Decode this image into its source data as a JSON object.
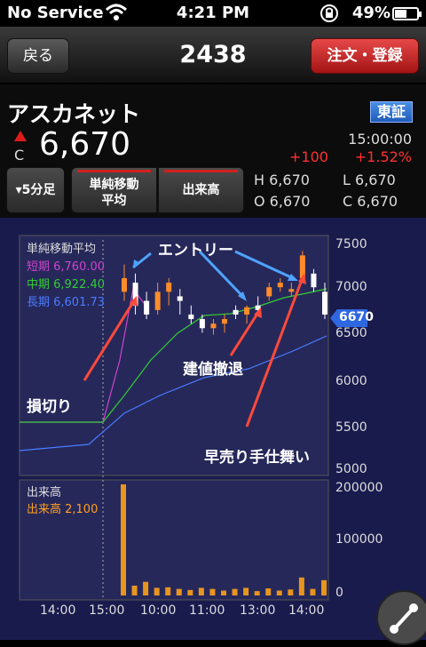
{
  "status": {
    "carrier": "No Service",
    "time": "4:21 PM",
    "battery": "49%"
  },
  "nav": {
    "back": "戻る",
    "title": "2438",
    "order": "注文・登録"
  },
  "stock": {
    "name": "アスカネット",
    "exchange": "東証",
    "price_label": "C",
    "price": "6,670",
    "time": "15:00:00",
    "change": "+100",
    "change_pct": "+1.52%"
  },
  "controls": {
    "period": "▾5分足",
    "ma": "単純移動\n平均",
    "volume": "出来高"
  },
  "ohlc": {
    "h": "H 6,670",
    "l": "L 6,670",
    "o": "O 6,670",
    "c": "C 6,670"
  },
  "chart": {
    "legend_title": "単純移動平均",
    "short": "短期 6,760.00",
    "mid": "中期 6,922.40",
    "long": "長期 6,601.73",
    "price_axis": [
      "7500",
      "7000",
      "6500",
      "6000",
      "5500",
      "5000"
    ],
    "current_tag": "6670",
    "vol_title": "出来高",
    "vol_value": "出来高 2,100",
    "vol_axis": [
      "200000",
      "100000",
      "0"
    ],
    "time_axis": [
      "14:00",
      "15:00",
      "10:00",
      "11:00",
      "13:00",
      "14:00"
    ],
    "annotations": {
      "entry": "エントリー",
      "breakeven": "建値撤退",
      "stop": "損切り",
      "early": "早売り手仕舞い"
    },
    "colors": {
      "short": "#cc44cc",
      "mid": "#33cc33",
      "long": "#4a7cff",
      "up": "#ff8c2a",
      "down": "#ffffff",
      "bg": "#1a1b4d"
    }
  },
  "chart_data": {
    "type": "candlestick",
    "ylim": [
      5000,
      7500
    ],
    "candles": [
      {
        "o": 6950,
        "h": 7250,
        "l": 6850,
        "c": 7100
      },
      {
        "o": 7050,
        "h": 7150,
        "l": 6700,
        "c": 6800
      },
      {
        "o": 6850,
        "h": 6950,
        "l": 6650,
        "c": 6700
      },
      {
        "o": 6750,
        "h": 7050,
        "l": 6700,
        "c": 6950
      },
      {
        "o": 6950,
        "h": 7100,
        "l": 6800,
        "c": 7050
      },
      {
        "o": 6900,
        "h": 6980,
        "l": 6700,
        "c": 6850
      },
      {
        "o": 6700,
        "h": 6800,
        "l": 6600,
        "c": 6650
      },
      {
        "o": 6650,
        "h": 6700,
        "l": 6500,
        "c": 6550
      },
      {
        "o": 6550,
        "h": 6650,
        "l": 6480,
        "c": 6600
      },
      {
        "o": 6600,
        "h": 6700,
        "l": 6500,
        "c": 6650
      },
      {
        "o": 6750,
        "h": 6800,
        "l": 6650,
        "c": 6700
      },
      {
        "o": 6700,
        "h": 6800,
        "l": 6600,
        "c": 6780
      },
      {
        "o": 6800,
        "h": 6900,
        "l": 6700,
        "c": 6750
      },
      {
        "o": 6900,
        "h": 7050,
        "l": 6850,
        "c": 7000
      },
      {
        "o": 7000,
        "h": 7100,
        "l": 6950,
        "c": 7050
      },
      {
        "o": 6950,
        "h": 7050,
        "l": 6900,
        "c": 6980
      },
      {
        "o": 7100,
        "h": 7400,
        "l": 7050,
        "c": 7350
      },
      {
        "o": 7150,
        "h": 7200,
        "l": 6950,
        "c": 7000
      },
      {
        "o": 6950,
        "h": 7050,
        "l": 6650,
        "c": 6700
      }
    ],
    "volume": [
      204000,
      18000,
      25000,
      14000,
      15000,
      12000,
      10000,
      14000,
      12000,
      9000,
      12000,
      14000,
      8000,
      13000,
      9000,
      11000,
      33000,
      12000,
      28000
    ]
  }
}
